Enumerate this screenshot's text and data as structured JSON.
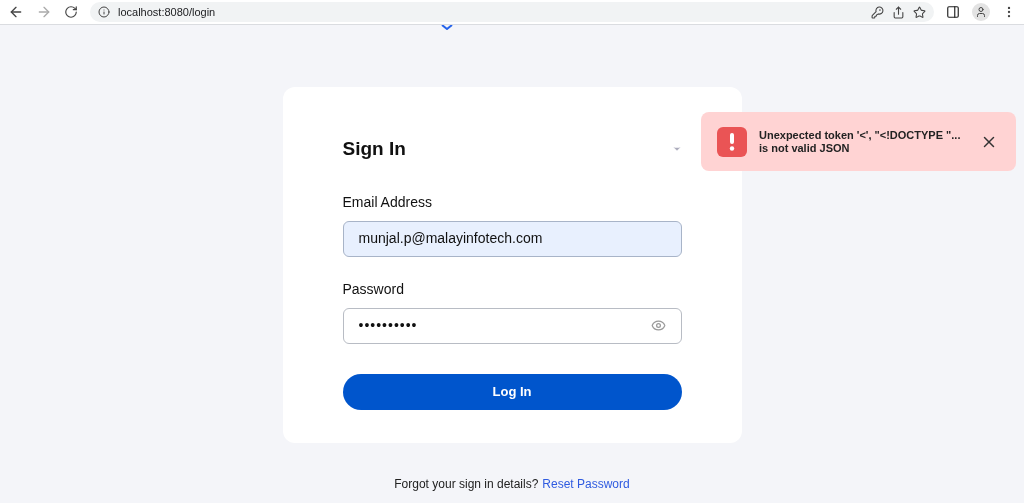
{
  "browser": {
    "url": "localhost:8080/login"
  },
  "form": {
    "title": "Sign In",
    "fields": [
      {
        "label": "Email Address",
        "value": "munjal.p@malayinfotech.com",
        "kind": "email",
        "focused": true
      },
      {
        "label": "Password",
        "value": "••••••••••",
        "kind": "password",
        "focused": false
      }
    ],
    "submit": "Log In"
  },
  "footer": {
    "text": "Forgot your sign in details?",
    "link": "Reset Password"
  },
  "toast": {
    "message": "Unexpected token '<', \"<!DOCTYPE \"... is not valid JSON"
  }
}
